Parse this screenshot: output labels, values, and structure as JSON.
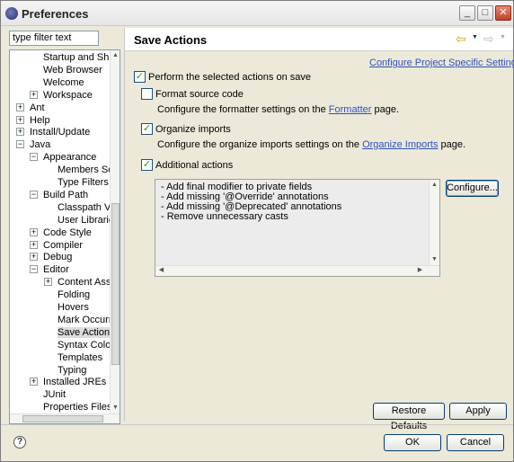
{
  "window": {
    "title": "Preferences"
  },
  "titlebar_buttons": {
    "minimize": "_",
    "maximize": "□",
    "close": "✕"
  },
  "filter": {
    "value": "type filter text"
  },
  "tree": [
    {
      "label": "Startup and Shutdown",
      "level": 2
    },
    {
      "label": "Web Browser",
      "level": 2
    },
    {
      "label": "Welcome",
      "level": 2
    },
    {
      "label": "Workspace",
      "level": 2,
      "toggle": "+"
    },
    {
      "label": "Ant",
      "level": 1,
      "toggle": "+"
    },
    {
      "label": "Help",
      "level": 1,
      "toggle": "+"
    },
    {
      "label": "Install/Update",
      "level": 1,
      "toggle": "+"
    },
    {
      "label": "Java",
      "level": 1,
      "toggle": "−"
    },
    {
      "label": "Appearance",
      "level": 2,
      "toggle": "−"
    },
    {
      "label": "Members Sort Order",
      "level": 3
    },
    {
      "label": "Type Filters",
      "level": 3
    },
    {
      "label": "Build Path",
      "level": 2,
      "toggle": "−"
    },
    {
      "label": "Classpath Variables",
      "level": 3
    },
    {
      "label": "User Libraries",
      "level": 3
    },
    {
      "label": "Code Style",
      "level": 2,
      "toggle": "+"
    },
    {
      "label": "Compiler",
      "level": 2,
      "toggle": "+"
    },
    {
      "label": "Debug",
      "level": 2,
      "toggle": "+"
    },
    {
      "label": "Editor",
      "level": 2,
      "toggle": "−"
    },
    {
      "label": "Content Assist",
      "level": 3,
      "toggle": "+"
    },
    {
      "label": "Folding",
      "level": 3
    },
    {
      "label": "Hovers",
      "level": 3
    },
    {
      "label": "Mark Occurrences",
      "level": 3
    },
    {
      "label": "Save Actions",
      "level": 3,
      "selected": true
    },
    {
      "label": "Syntax Coloring",
      "level": 3
    },
    {
      "label": "Templates",
      "level": 3
    },
    {
      "label": "Typing",
      "level": 3
    },
    {
      "label": "Installed JREs",
      "level": 2,
      "toggle": "+"
    },
    {
      "label": "JUnit",
      "level": 2
    },
    {
      "label": "Properties Files Editor",
      "level": 2
    }
  ],
  "page": {
    "title": "Save Actions",
    "configure_link": "Configure Project Specific Settings...",
    "perform": {
      "label": "Perform the selected actions on save",
      "checked": true
    },
    "format": {
      "label": "Format source code",
      "checked": false,
      "desc_pre": "Configure the formatter settings on the ",
      "desc_link": "Formatter",
      "desc_post": " page."
    },
    "organize": {
      "label": "Organize imports",
      "checked": true,
      "desc_pre": "Configure the organize imports settings on the ",
      "desc_link": "Organize Imports",
      "desc_post": " page."
    },
    "additional": {
      "label": "Additional actions",
      "checked": true
    },
    "actions": [
      "- Add final modifier to private fields",
      "- Add missing '@Override' annotations",
      "- Add missing '@Deprecated' annotations",
      "- Remove unnecessary casts"
    ],
    "configure_button": "Configure...",
    "restore_button": "Restore Defaults",
    "apply_button": "Apply"
  },
  "footer": {
    "ok": "OK",
    "cancel": "Cancel",
    "help": "?"
  }
}
